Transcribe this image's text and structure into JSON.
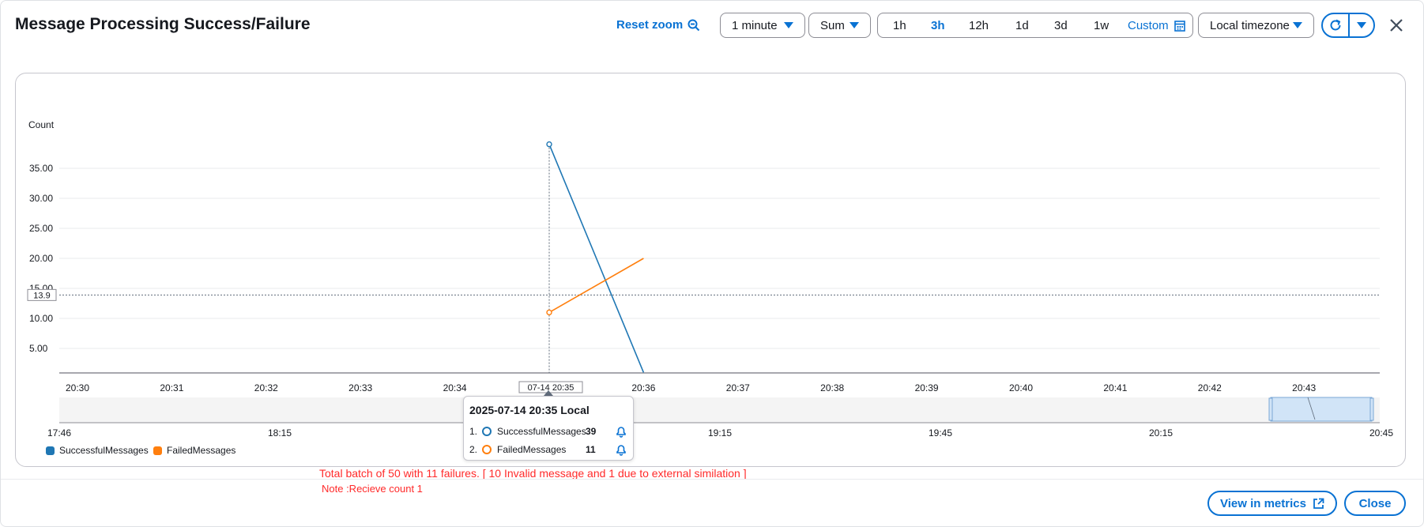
{
  "dialog": {
    "title": "Message Processing Success/Failure",
    "reset_zoom_label": "Reset zoom",
    "period_select": "1 minute",
    "stat_select": "Sum",
    "ranges": [
      "1h",
      "3h",
      "12h",
      "1d",
      "3d",
      "1w"
    ],
    "active_range": "3h",
    "custom_label": "Custom",
    "timezone_select": "Local timezone",
    "view_metrics_label": "View in metrics",
    "close_label": "Close"
  },
  "colors": {
    "accent": "#0972d3",
    "successful": "#1f77b4",
    "failed": "#ff7f0e",
    "note": "#ff2a2a"
  },
  "chart_data": {
    "type": "line",
    "ylabel": "Count",
    "y_ticks": [
      "5.00",
      "10.00",
      "15.00",
      "20.00",
      "25.00",
      "30.00",
      "35.00"
    ],
    "x_ticks": [
      "20:30",
      "20:31",
      "20:32",
      "20:33",
      "20:34",
      "20:35",
      "20:36",
      "20:37",
      "20:38",
      "20:39",
      "20:40",
      "20:41",
      "20:42",
      "20:43"
    ],
    "xlim": [
      "20:30",
      "20:44"
    ],
    "ylim": [
      1,
      39
    ],
    "series": [
      {
        "name": "SuccessfulMessages",
        "x": [
          "20:35",
          "20:36"
        ],
        "values": [
          39,
          1
        ]
      },
      {
        "name": "FailedMessages",
        "x": [
          "20:35",
          "20:36"
        ],
        "values": [
          11,
          20
        ]
      }
    ],
    "hover_y_label": "13.9",
    "hover_x_label": "07-14 20:35",
    "overview_ticks": [
      "17:46",
      "18:15",
      "19:15",
      "19:45",
      "20:15",
      "20:45"
    ]
  },
  "tooltip": {
    "title": "2025-07-14 20:35 Local",
    "rows": [
      {
        "index": "1.",
        "name": "SuccessfulMessages",
        "value": "39"
      },
      {
        "index": "2.",
        "name": "FailedMessages",
        "value": "11"
      }
    ]
  },
  "legend": [
    {
      "name": "SuccessfulMessages"
    },
    {
      "name": "FailedMessages"
    }
  ],
  "notes": {
    "line1": "Total batch of 50 with 11 failures. [ 10 Invalid message and 1 due to external similation ]",
    "line2": "Note :Recieve count 1"
  }
}
